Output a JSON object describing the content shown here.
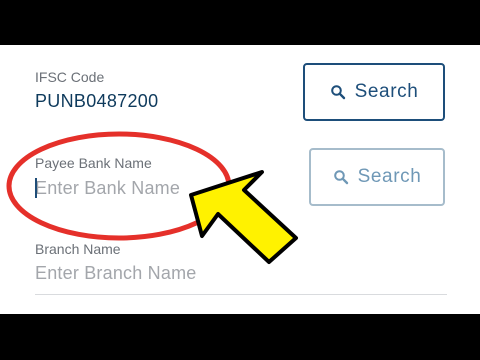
{
  "form": {
    "ifsc": {
      "label": "IFSC Code",
      "value": "PUNB0487200"
    },
    "payee_bank": {
      "label": "Payee Bank Name",
      "placeholder": "Enter Bank Name",
      "value": ""
    },
    "branch": {
      "label": "Branch Name",
      "placeholder": "Enter Branch Name",
      "value": ""
    }
  },
  "buttons": {
    "ifsc_search_label": "Search",
    "bank_search_label": "Search"
  },
  "icons": {
    "search": "magnifier-icon"
  },
  "annotation": {
    "highlight_color": "#e5302a",
    "arrow_fill": "#fff200",
    "arrow_stroke": "#000000"
  },
  "colors": {
    "primary": "#1d4e7a",
    "disabled_border": "#a6bccb",
    "disabled_text": "#6f98b6",
    "placeholder": "#a3a6ab",
    "label": "#6b7077"
  }
}
